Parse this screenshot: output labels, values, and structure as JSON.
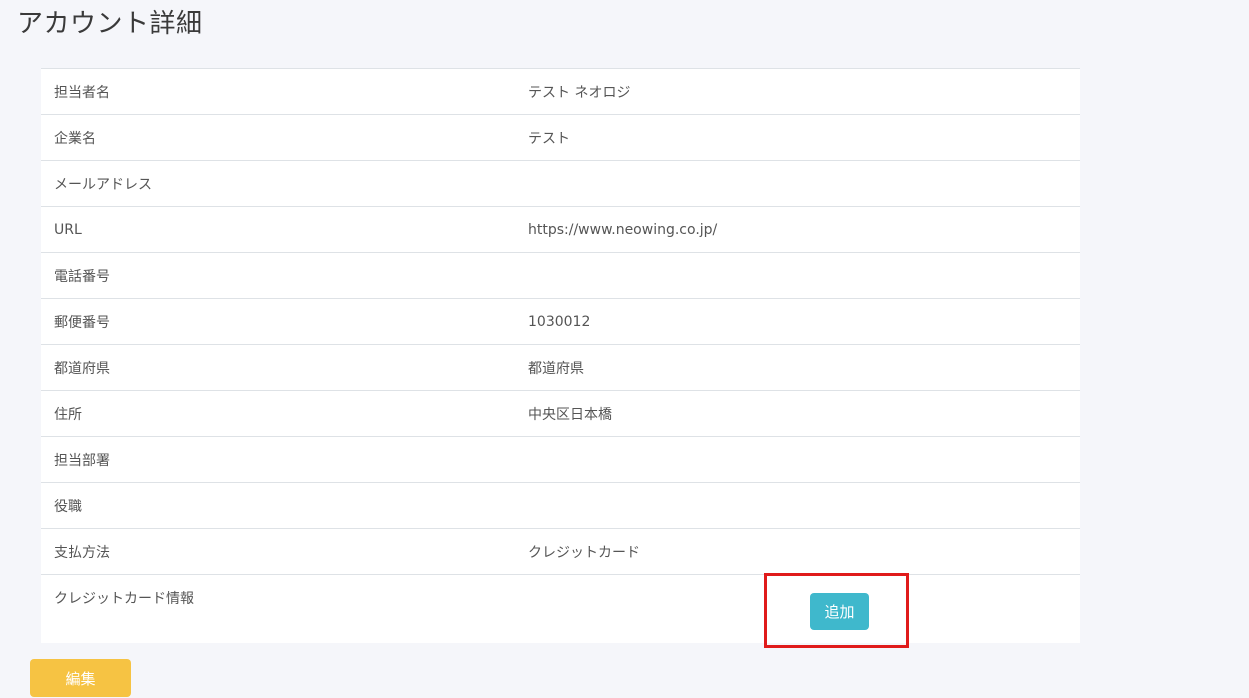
{
  "page": {
    "title": "アカウント詳細"
  },
  "details": {
    "rows": [
      {
        "label": "担当者名",
        "value": "テスト ネオロジ"
      },
      {
        "label": "企業名",
        "value": "テスト"
      },
      {
        "label": "メールアドレス",
        "value": ""
      },
      {
        "label": "URL",
        "value": "https://www.neowing.co.jp/"
      },
      {
        "label": "電話番号",
        "value": ""
      },
      {
        "label": "郵便番号",
        "value": "1030012"
      },
      {
        "label": "都道府県",
        "value": "都道府県"
      },
      {
        "label": "住所",
        "value": "中央区日本橋"
      },
      {
        "label": "担当部署",
        "value": ""
      },
      {
        "label": "役職",
        "value": ""
      },
      {
        "label": "支払方法",
        "value": "クレジットカード"
      },
      {
        "label": "クレジットカード情報",
        "value": ""
      }
    ]
  },
  "buttons": {
    "add_label": "追加",
    "edit_label": "編集"
  },
  "colors": {
    "add_button": "#3fb8cc",
    "edit_button": "#f6c343",
    "highlight": "#e01b1b"
  }
}
